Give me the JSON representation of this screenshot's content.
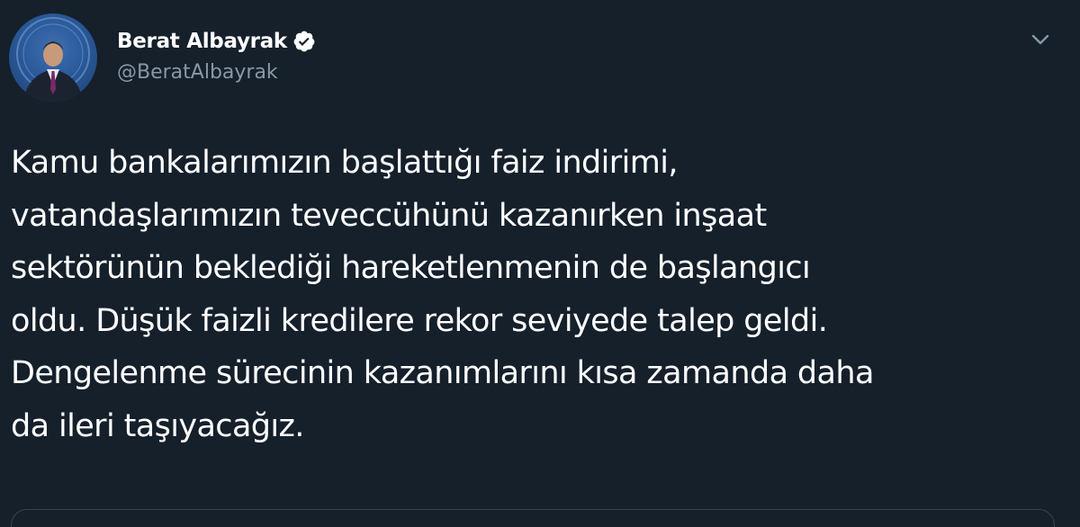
{
  "tweet": {
    "author": {
      "display_name": "Berat Albayrak",
      "handle": "@BeratAlbayrak",
      "verified": true,
      "avatar_icon": "profile-photo"
    },
    "menu_icon": "chevron-down-icon",
    "text": "Kamu bankalarımızın başlattığı faiz indirimi,\nvatandaşlarımızın teveccühünü kazanırken inşaat\nsektörünün beklediği hareketlenmenin de başlangıcı\noldu. Düşük faizli kredilere rekor seviyede talep geldi.\nDengelenme sürecinin kazanımlarını kısa zamanda daha\nda ileri taşıyacağız."
  },
  "colors": {
    "background": "#15202b",
    "text": "#ffffff",
    "secondary_text": "#8899a6",
    "verified_badge": "#ffffff",
    "border": "#38444d"
  }
}
